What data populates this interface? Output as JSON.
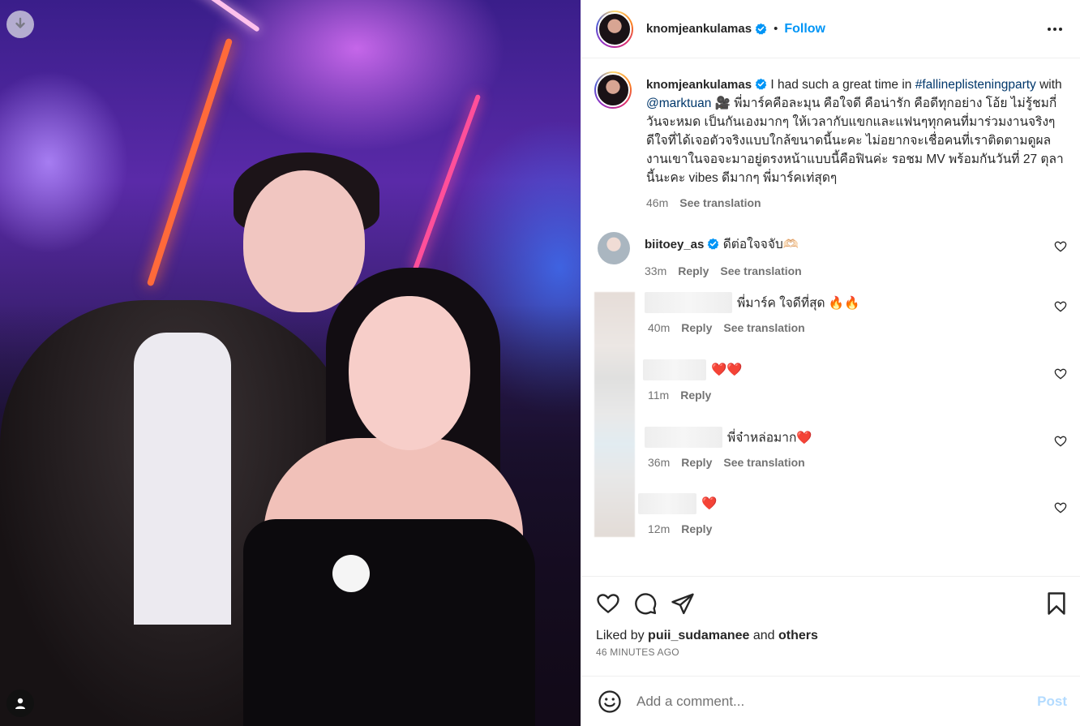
{
  "post": {
    "author": "knomjeankulamas",
    "follow_label": "Follow",
    "separator": "•"
  },
  "caption": {
    "author": "knomjeankulamas",
    "text_intro": " I had such a great time in ",
    "hashtag": "#fallineplisteningparty",
    "with_text": " with ",
    "mention": "@marktuan",
    "emoji": " 🎥 ",
    "body": "พี่มาร์คคือละมุน คือใจดี คือน่ารัก คือดีทุกอย่าง โอ้ย ไม่รู้ชมกี่วันจะหมด เป็นกันเองมากๆ ให้เวลากับแขกและแฟนๆทุกคนที่มาร่วมงานจริงๆ ดีใจที่ได้เจอตัวจริงแบบใกล้ขนาดนี้นะคะ ไม่อยากจะเชื่อคนที่เราติดตามดูผลงานเขาในจอจะมาอยู่ตรงหน้าแบบนี้คือฟินค่ะ รอชม MV พร้อมกันวันที่ 27 ตุลานี้นะคะ vibes ดีมากๆ พี่มาร์คเท่สุดๆ",
    "time": "46m",
    "see_translation": "See translation"
  },
  "comments": [
    {
      "username": "biitoey_as",
      "text": "ดีต่อใจจจับ🫶🏻",
      "time": "33m",
      "reply_label": "Reply",
      "see_translation": "See translation"
    }
  ],
  "replies": [
    {
      "text": "พี่มาร์ค ใจดีที่สุด 🔥🔥",
      "time": "40m",
      "reply_label": "Reply",
      "see_translation": "See translation"
    },
    {
      "text": "❤️❤️",
      "time": "11m",
      "reply_label": "Reply"
    },
    {
      "text": "พี่จ๋าหล่อมาก❤️",
      "time": "36m",
      "reply_label": "Reply",
      "see_translation": "See translation"
    },
    {
      "text": "❤️",
      "time": "12m",
      "reply_label": "Reply"
    }
  ],
  "likes": {
    "prefix": "Liked by ",
    "user": "puii_sudamanee",
    "middle": " and ",
    "others": "others",
    "timestamp": "46 MINUTES AGO"
  },
  "add_comment": {
    "placeholder": "Add a comment...",
    "post_label": "Post"
  },
  "icons": {
    "download": "download-icon",
    "user": "user-icon",
    "verified": "verified-badge-icon",
    "more": "more-icon",
    "heart": "heart-icon",
    "comment": "comment-icon",
    "share": "share-icon",
    "bookmark": "bookmark-icon",
    "emoji": "emoji-icon"
  },
  "colors": {
    "accent": "#0095f6",
    "link": "#00376b",
    "muted": "#737373",
    "post_disabled": "#b3dbff"
  }
}
